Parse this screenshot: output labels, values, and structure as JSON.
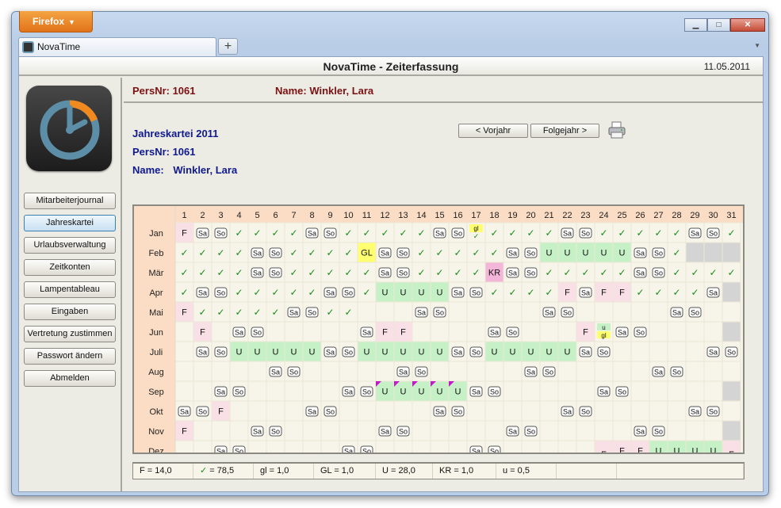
{
  "browser": {
    "menu_label": "Firefox",
    "tab_title": "NovaTime",
    "new_tab_label": "+",
    "window_buttons": {
      "minimize": "▁",
      "maximize": "□",
      "close": "✕"
    }
  },
  "app": {
    "title": "NovaTime - Zeiterfassung",
    "date": "11.05.2011"
  },
  "sidebar": {
    "items": [
      {
        "label": "Mitarbeiterjournal"
      },
      {
        "label": "Jahreskartei"
      },
      {
        "label": "Urlaubsverwaltung"
      },
      {
        "label": "Zeitkonten"
      },
      {
        "label": "Lampentableau"
      },
      {
        "label": "Eingaben"
      },
      {
        "label": "Vertretung zustimmen"
      },
      {
        "label": "Passwort ändern"
      },
      {
        "label": "Abmelden"
      }
    ],
    "active_index": 1
  },
  "header": {
    "persnr": "PersNr: 1061",
    "name": "Name: Winkler, Lara"
  },
  "info": {
    "title": "Jahreskartei 2011",
    "persnr": "PersNr: 1061",
    "name_label": "Name:",
    "name_value": "Winkler, Lara"
  },
  "buttons": {
    "prev_year": "< Vorjahr",
    "next_year": "Folgejahr >",
    "print_icon": "printer-icon"
  },
  "calendar": {
    "days": [
      "1",
      "2",
      "3",
      "4",
      "5",
      "6",
      "7",
      "8",
      "9",
      "10",
      "11",
      "12",
      "13",
      "14",
      "15",
      "16",
      "17",
      "18",
      "19",
      "20",
      "21",
      "22",
      "23",
      "24",
      "25",
      "26",
      "27",
      "28",
      "29",
      "30",
      "31"
    ],
    "months": [
      {
        "name": "Jan",
        "cells": [
          "F",
          "Sa",
          "So",
          "✓",
          "✓",
          "✓",
          "✓",
          "Sa",
          "So",
          "✓",
          "✓",
          "✓",
          "✓",
          "✓",
          "Sa",
          "So",
          "gl|✓",
          "✓",
          "✓",
          "✓",
          "✓",
          "Sa",
          "So",
          "✓",
          "✓",
          "✓",
          "✓",
          "✓",
          "Sa",
          "So",
          "✓"
        ]
      },
      {
        "name": "Feb",
        "cells": [
          "✓",
          "✓",
          "✓",
          "✓",
          "Sa",
          "So",
          "✓",
          "✓",
          "✓",
          "✓",
          "GL",
          "Sa",
          "So",
          "✓",
          "✓",
          "✓",
          "✓",
          "✓",
          "Sa",
          "So",
          "U",
          "U",
          "U",
          "U",
          "U",
          "Sa",
          "So",
          "✓",
          "X",
          "X",
          "X"
        ]
      },
      {
        "name": "Mär",
        "cells": [
          "✓",
          "✓",
          "✓",
          "✓",
          "Sa",
          "So",
          "✓",
          "✓",
          "✓",
          "✓",
          "✓",
          "Sa",
          "So",
          "✓",
          "✓",
          "✓",
          "✓",
          "KR",
          "Sa",
          "So",
          "✓",
          "✓",
          "✓",
          "✓",
          "✓",
          "Sa",
          "So",
          "✓",
          "✓",
          "✓",
          "✓"
        ]
      },
      {
        "name": "Apr",
        "cells": [
          "✓",
          "Sa",
          "So",
          "✓",
          "✓",
          "✓",
          "✓",
          "✓",
          "Sa",
          "So",
          "✓",
          "U",
          "U",
          "U",
          "U",
          "Sa",
          "So",
          "✓",
          "✓",
          "✓",
          "✓",
          "F",
          "Sa",
          "F",
          "F",
          "✓",
          "✓",
          "✓",
          "✓",
          "Sa",
          "X"
        ]
      },
      {
        "name": "Mai",
        "cells": [
          "F",
          "✓",
          "✓",
          "✓",
          "✓",
          "✓",
          "Sa",
          "So",
          "✓",
          "✓",
          "",
          "",
          "",
          "Sa",
          "So",
          "",
          "",
          "",
          "",
          "",
          "Sa",
          "So",
          "",
          "",
          "",
          "",
          "",
          "Sa",
          "So",
          "",
          ""
        ]
      },
      {
        "name": "Jun",
        "cells": [
          "",
          "F",
          "",
          "Sa",
          "So",
          "",
          "",
          "",
          "",
          "",
          "Sa",
          "F",
          "F",
          "",
          "",
          "",
          "",
          "Sa",
          "So",
          "",
          "",
          "",
          "F",
          "u|gl",
          "Sa",
          "So",
          "",
          "",
          "",
          "",
          "X"
        ]
      },
      {
        "name": "Juli",
        "cells": [
          "",
          "Sa",
          "So",
          "U",
          "U",
          "U",
          "U",
          "U",
          "Sa",
          "So",
          "U",
          "U",
          "U",
          "U",
          "U",
          "Sa",
          "So",
          "U",
          "U",
          "U",
          "U",
          "U",
          "Sa",
          "So",
          "",
          "",
          "",
          "",
          "",
          "Sa",
          "So"
        ]
      },
      {
        "name": "Aug",
        "cells": [
          "",
          "",
          "",
          "",
          "",
          "Sa",
          "So",
          "",
          "",
          "",
          "",
          "",
          "Sa",
          "So",
          "",
          "",
          "",
          "",
          "",
          "Sa",
          "So",
          "",
          "",
          "",
          "",
          "",
          "Sa",
          "So",
          "",
          "",
          ""
        ]
      },
      {
        "name": "Sep",
        "cells": [
          "",
          "",
          "Sa",
          "So",
          "",
          "",
          "",
          "",
          "",
          "Sa",
          "So",
          "U",
          "U",
          "U",
          "U",
          "U",
          "Sa",
          "So",
          "",
          "",
          "",
          "",
          "",
          "Sa",
          "So",
          "",
          "",
          "",
          "",
          "",
          "X"
        ]
      },
      {
        "name": "Okt",
        "cells": [
          "Sa",
          "So",
          "F",
          "",
          "",
          "",
          "",
          "Sa",
          "So",
          "",
          "",
          "",
          "",
          "",
          "Sa",
          "So",
          "",
          "",
          "",
          "",
          "",
          "Sa",
          "So",
          "",
          "",
          "",
          "",
          "",
          "Sa",
          "So",
          ""
        ]
      },
      {
        "name": "Nov",
        "cells": [
          "F",
          "",
          "",
          "",
          "Sa",
          "So",
          "",
          "",
          "",
          "",
          "",
          "Sa",
          "So",
          "",
          "",
          "",
          "",
          "",
          "Sa",
          "So",
          "",
          "",
          "",
          "",
          "",
          "Sa",
          "So",
          "",
          "",
          "",
          "X"
        ]
      },
      {
        "name": "Dez",
        "cells": [
          "",
          "",
          "Sa",
          "So",
          "",
          "",
          "",
          "",
          "",
          "Sa",
          "So",
          "",
          "",
          "",
          "",
          "",
          "Sa",
          "So",
          "",
          "",
          "",
          "",
          "",
          "F",
          "F",
          "F",
          "U",
          "U",
          "U",
          "U",
          "F"
        ]
      }
    ]
  },
  "summary": {
    "items": [
      "F  = 14,0",
      "✓  = 78,5",
      "gl  = 1,0",
      "GL  = 1,0",
      "U  = 28,0",
      "KR  = 1,0",
      "u  = 0,5",
      "",
      ""
    ]
  },
  "colors": {
    "header_text": "#7a1212",
    "info_text": "#101a8c",
    "vacation_green": "#c6f0c6",
    "holiday_pink": "#f9dfe6",
    "gl_yellow": "#ffff70",
    "kr_pink": "#f4b6d8",
    "day_header_bg": "#fbdcc4",
    "disabled_gray": "#d4d4d4",
    "check_green": "#1a8a1a",
    "logo_orange": "#f08a1e",
    "logo_blue": "#5c8ea7"
  }
}
